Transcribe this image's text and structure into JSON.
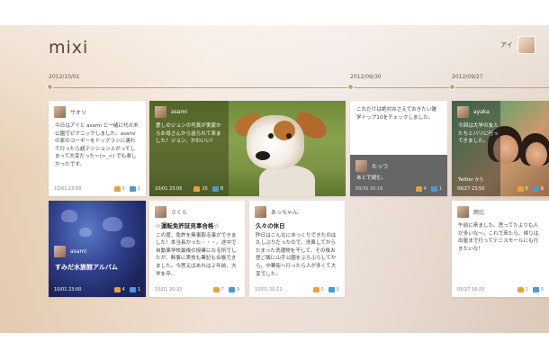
{
  "app": {
    "logo": "mixi"
  },
  "user": {
    "name": "アイ"
  },
  "timeline": {
    "dates": [
      "2012/10/01",
      "2012/09/30",
      "2012/09/27"
    ]
  },
  "cards": {
    "saori": {
      "name": "サオリ",
      "text": "今日はアイと asami と一緒に代々木公園でピクニックしました。asamiの家のコーギーをドッグランに連れて行ったら超テンション上がってしまって大変だった～(>_<) でも楽しかったです。",
      "time": "10/01 23:00",
      "likes": "5",
      "comments": "1"
    },
    "asami_dog": {
      "name": "asami",
      "text": "愛しのジョンの写真が実家からお母さんから送られて来ました！ジョン、かわいい！",
      "time": "10/01 23:05",
      "likes": "15",
      "comments": "8"
    },
    "asami_aqua": {
      "name": "asami",
      "title": "すみだ水族館アルバム",
      "time": "10/01 23:00",
      "likes": "4",
      "comments": "1"
    },
    "sakura": {
      "name": "さくら",
      "title": "☆運転免許証見事合格☆",
      "text": "この度、免許を無事取る事ができました！本当長かった・・・。途中で自動車学校最後の授業になる所でしたが、無事に実技も筆記も合格できました。今思えばあれは２年前、大学を卒...",
      "time": "10/01 20:32",
      "likes": "7",
      "comments": "9"
    },
    "acchan": {
      "name": "あっちゃん",
      "title": "久々の休日",
      "text": "昨日はこんなにゆっくりできたのは久しぶりだったので、洗車してからたまった洗濯物を干して、その後お昼ご飯に山手公園をぶらぶらしてから、中華街へ行ったら人が多くて大変でした。",
      "time": "10/01 20:12",
      "likes": "5",
      "comments": "5"
    },
    "checklist": {
      "text": "これだけは絶対おさえておきたい雑学トップ10をチェックしました。",
      "reply_name": "たっつ",
      "reply_text": "あとで読む。",
      "time": "09/30 20:16",
      "likes": "4",
      "comments": "1"
    },
    "ayaka": {
      "name": "ayaka",
      "text": "今回は大学の友人たちとバリに行ってきました。",
      "source": "Twitter から",
      "time": "09/27 23:50",
      "likes": "5",
      "comments": "6"
    },
    "yumi": {
      "name": "雨比",
      "text": "午前に来ました。思ってたよりも人が多いな～。これで来たら、帰りは出屋まで行ってテニスモールにも行きたいな！",
      "time": "09/27 16:20",
      "likes": "1",
      "comments": "5"
    }
  }
}
